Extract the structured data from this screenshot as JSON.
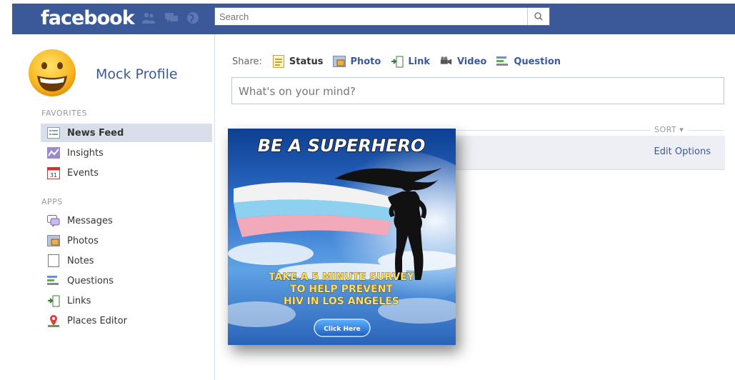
{
  "header": {
    "logo": "facebook",
    "search": {
      "placeholder": "Search"
    }
  },
  "profile": {
    "name": "Mock Profile"
  },
  "sidebar": {
    "favorites_heading": "FAVORITES",
    "favorites": [
      {
        "label": "News Feed",
        "icon": "news-feed-icon",
        "selected": true
      },
      {
        "label": "Insights",
        "icon": "insights-icon"
      },
      {
        "label": "Events",
        "icon": "events-icon"
      }
    ],
    "apps_heading": "APPS",
    "apps": [
      {
        "label": "Messages",
        "icon": "messages-icon"
      },
      {
        "label": "Photos",
        "icon": "photos-icon"
      },
      {
        "label": "Notes",
        "icon": "notes-icon"
      },
      {
        "label": "Questions",
        "icon": "questions-icon"
      },
      {
        "label": "Links",
        "icon": "links-icon"
      },
      {
        "label": "Places Editor",
        "icon": "places-editor-icon"
      }
    ]
  },
  "composer": {
    "share_label": "Share:",
    "options": [
      {
        "label": "Status",
        "icon": "status-icon",
        "active": true
      },
      {
        "label": "Photo",
        "icon": "photo-icon"
      },
      {
        "label": "Link",
        "icon": "link-icon"
      },
      {
        "label": "Video",
        "icon": "video-icon"
      },
      {
        "label": "Question",
        "icon": "question-icon"
      }
    ],
    "placeholder": "What's on your mind?"
  },
  "feed": {
    "sort_label": "SORT ▾",
    "edit_options": "Edit Options"
  },
  "ad": {
    "headline": "BE A SUPERHERO",
    "body_lines": [
      "TAKE A 5 MINUTE SURVEY",
      "TO HELP PREVENT",
      "HIV IN LOS ANGELES"
    ],
    "cta": "Click Here"
  },
  "colors": {
    "brand_blue": "#3b5998",
    "link_blue": "#3b5998",
    "selected_bg": "#d8dfea",
    "feed_bar_bg": "#edeff4"
  }
}
